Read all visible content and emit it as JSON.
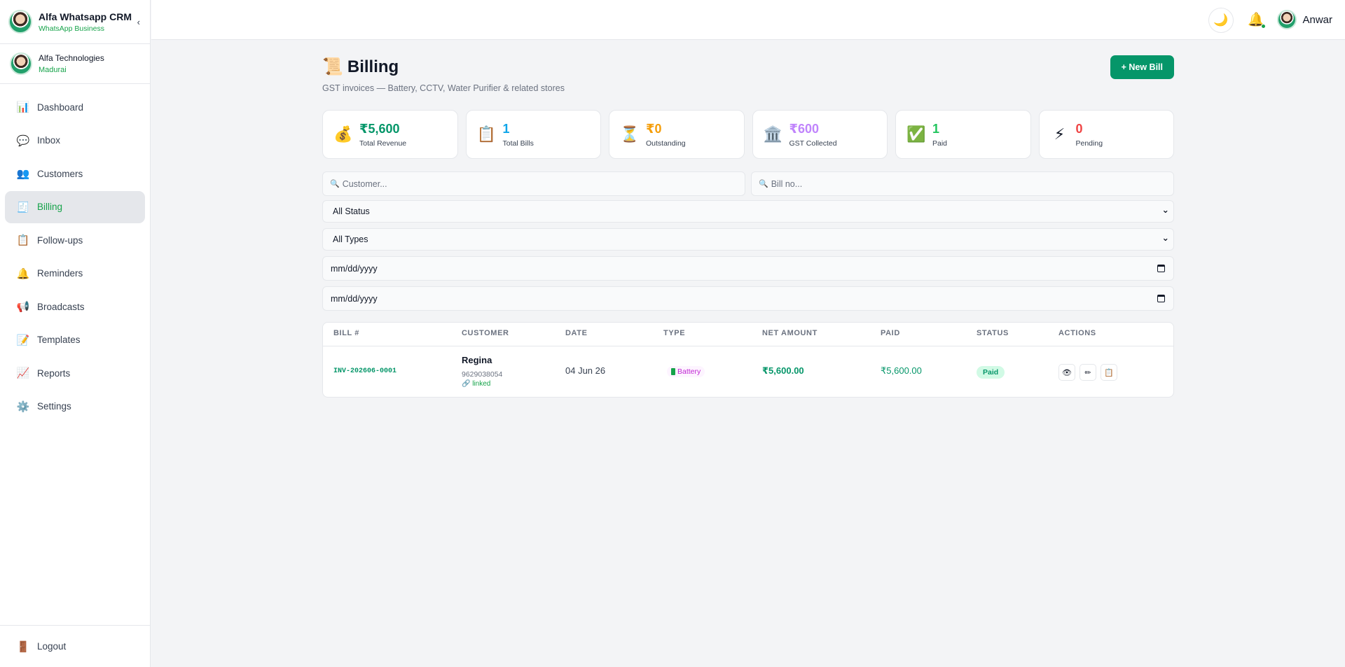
{
  "brand": {
    "title": "Alfa Whatsapp CRM",
    "subtitle": "WhatsApp Business",
    "collapse": "‹"
  },
  "org": {
    "name": "Alfa Technologies",
    "city": "Madurai"
  },
  "nav": {
    "items": [
      {
        "label": "Dashboard",
        "icon": "📊"
      },
      {
        "label": "Inbox",
        "icon": "💬"
      },
      {
        "label": "Customers",
        "icon": "👥"
      },
      {
        "label": "Billing",
        "icon": "🧾"
      },
      {
        "label": "Follow-ups",
        "icon": "📋"
      },
      {
        "label": "Reminders",
        "icon": "🔔"
      },
      {
        "label": "Broadcasts",
        "icon": "📢"
      },
      {
        "label": "Templates",
        "icon": "📝"
      },
      {
        "label": "Reports",
        "icon": "📈"
      },
      {
        "label": "Settings",
        "icon": "⚙️"
      }
    ],
    "logout": {
      "label": "Logout",
      "icon": "🚪"
    }
  },
  "topbar": {
    "theme_icon": "🌙",
    "bell_icon": "🔔",
    "user_name": "Anwar"
  },
  "page": {
    "title_icon": "📜",
    "title": "Billing",
    "subtitle": "GST invoices — Battery, CCTV, Water Purifier & related stores",
    "new_bill_label": "+ New Bill"
  },
  "stats": [
    {
      "icon": "💰",
      "value": "₹5,600",
      "label": "Total Revenue",
      "color": "#059669"
    },
    {
      "icon": "📋",
      "value": "1",
      "label": "Total Bills",
      "color": "#0ea5e9"
    },
    {
      "icon": "⏳",
      "value": "₹0",
      "label": "Outstanding",
      "color": "#f59e0b"
    },
    {
      "icon": "🏛️",
      "value": "₹600",
      "label": "GST Collected",
      "color": "#c084fc"
    },
    {
      "icon": "✅",
      "value": "1",
      "label": "Paid",
      "color": "#22c55e"
    },
    {
      "icon": "⚡",
      "value": "0",
      "label": "Pending",
      "color": "#ef4444"
    }
  ],
  "filters": {
    "customer_placeholder": "Customer...",
    "bill_placeholder": "Bill no...",
    "search_icon": "🔍",
    "status_selected": "All Status",
    "type_selected": "All Types",
    "date_from": "mm/dd/yyyy",
    "date_to": "mm/dd/yyyy",
    "chevron": "⌄"
  },
  "table": {
    "columns": [
      "BILL #",
      "CUSTOMER",
      "DATE",
      "TYPE",
      "NET AMOUNT",
      "PAID",
      "STATUS",
      "ACTIONS"
    ],
    "rows": [
      {
        "bill_no": "INV-202606-0001",
        "customer": "Regina",
        "phone": "9629038054",
        "linked": "🔗 linked",
        "date": "04 Jun 26",
        "type": "Battery",
        "net_amount": "₹5,600.00",
        "paid": "₹5,600.00",
        "status": "Paid",
        "actions": [
          "👁",
          "✏",
          "📋"
        ]
      }
    ]
  }
}
